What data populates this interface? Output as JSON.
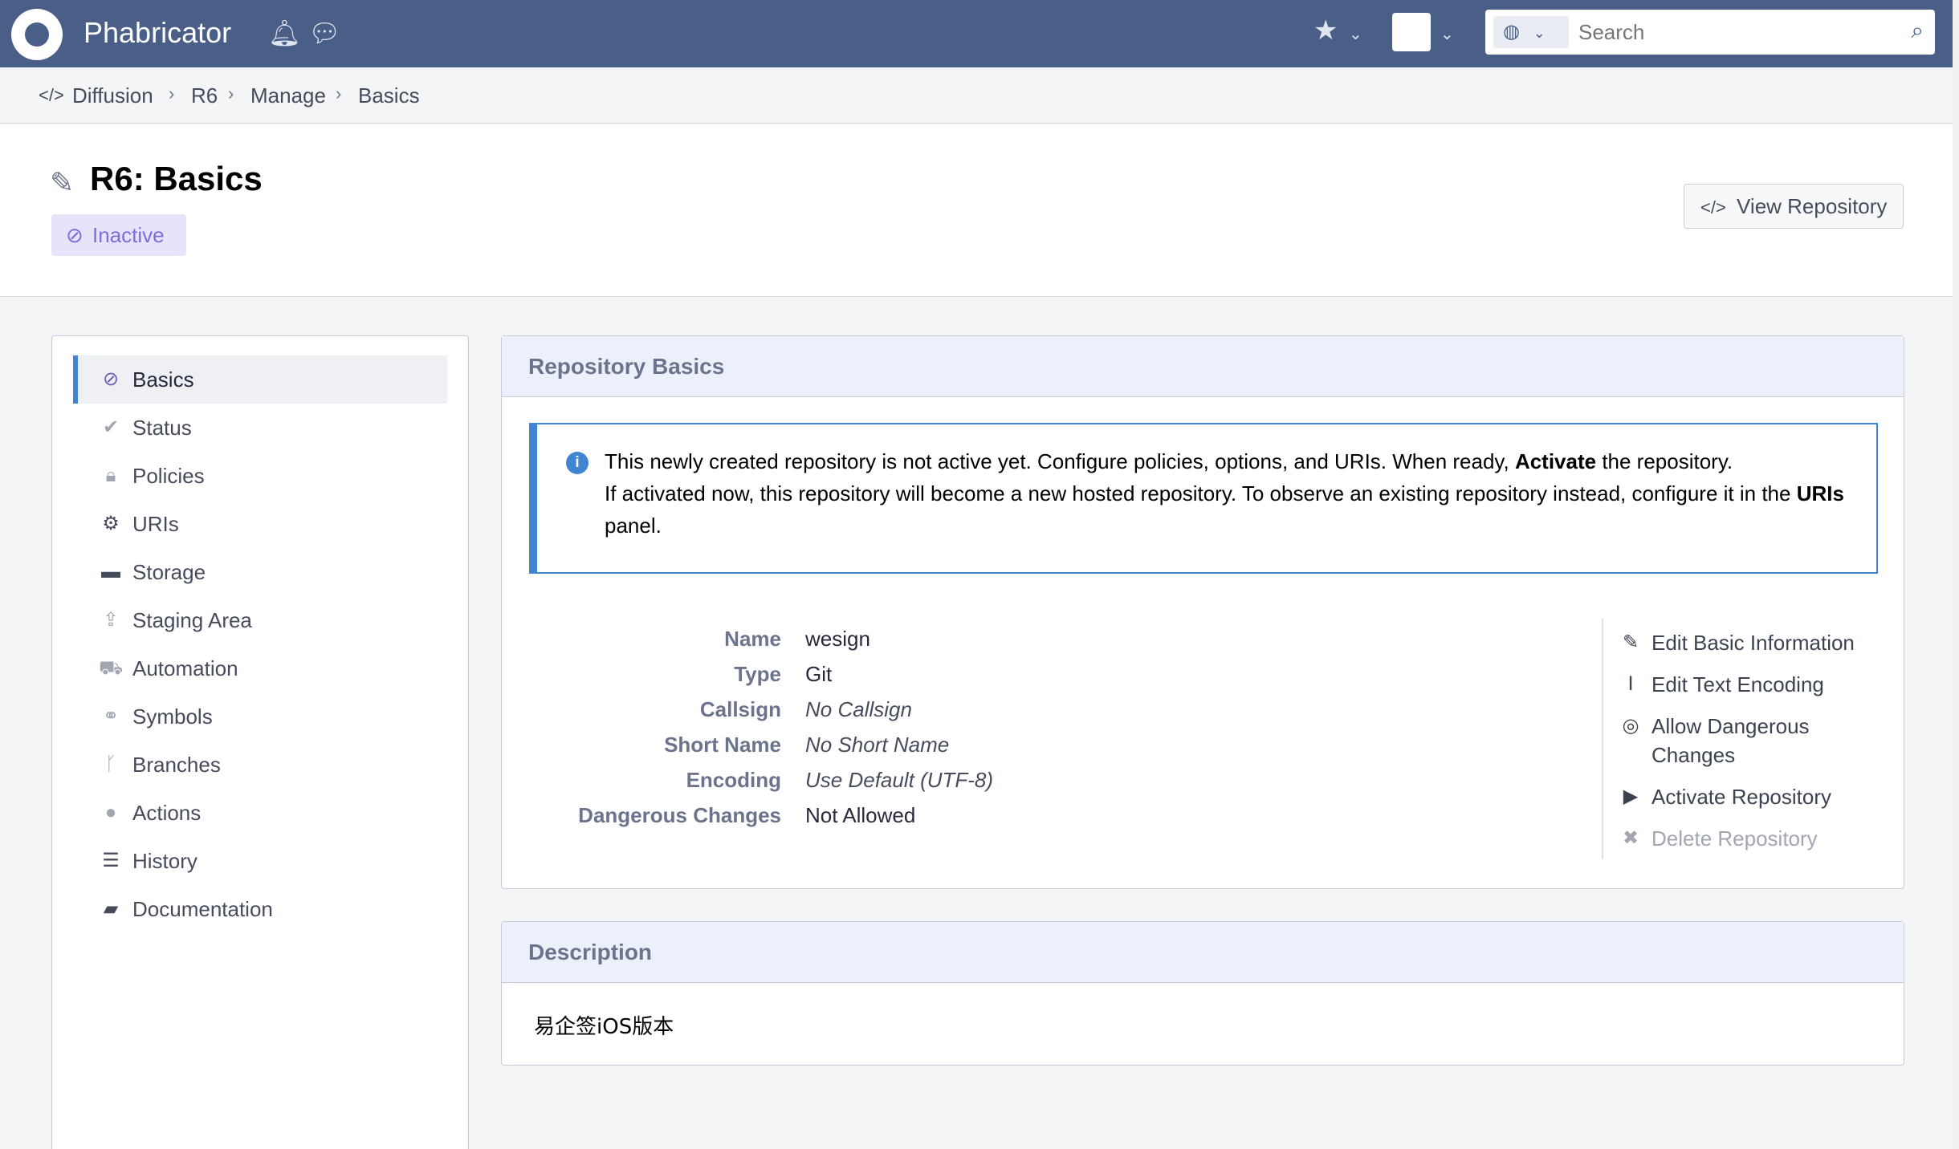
{
  "topbar": {
    "brand": "Phabricator",
    "search_placeholder": "Search"
  },
  "breadcrumbs": [
    "Diffusion",
    "R6",
    "Manage",
    "Basics"
  ],
  "header": {
    "title": "R6: Basics",
    "status": "Inactive",
    "view_button": "View Repository"
  },
  "sidebar": {
    "items": [
      {
        "label": "Basics",
        "icon": "ban-icon"
      },
      {
        "label": "Status",
        "icon": "check-icon"
      },
      {
        "label": "Policies",
        "icon": "lock-icon"
      },
      {
        "label": "URIs",
        "icon": "gears-icon"
      },
      {
        "label": "Storage",
        "icon": "folder-icon"
      },
      {
        "label": "Staging Area",
        "icon": "upload-icon"
      },
      {
        "label": "Automation",
        "icon": "truck-icon"
      },
      {
        "label": "Symbols",
        "icon": "link-icon"
      },
      {
        "label": "Branches",
        "icon": "branch-icon"
      },
      {
        "label": "Actions",
        "icon": "comment-icon"
      },
      {
        "label": "History",
        "icon": "list-icon"
      },
      {
        "label": "Documentation",
        "icon": "book-icon"
      }
    ]
  },
  "basics_panel": {
    "title": "Repository Basics",
    "notice_line1_pre": "This newly created repository is not active yet. Configure policies, options, and URIs. When ready, ",
    "notice_activate": "Activate",
    "notice_line1_post": " the repository.",
    "notice_line2_pre": "If activated now, this repository will become a new hosted repository. To observe an existing repository instead, configure it in the ",
    "notice_uris": "URIs",
    "notice_line2_post": " panel.",
    "properties": [
      {
        "label": "Name",
        "value": "wesign"
      },
      {
        "label": "Type",
        "value": "Git"
      },
      {
        "label": "Callsign",
        "value": "No Callsign"
      },
      {
        "label": "Short Name",
        "value": "No Short Name"
      },
      {
        "label": "Encoding",
        "value": "Use Default (UTF-8)"
      },
      {
        "label": "Dangerous Changes",
        "value": "Not Allowed"
      }
    ],
    "actions": [
      {
        "label": "Edit Basic Information"
      },
      {
        "label": "Edit Text Encoding"
      },
      {
        "label": "Allow Dangerous Changes"
      },
      {
        "label": "Activate Repository"
      },
      {
        "label": "Delete Repository"
      }
    ]
  },
  "description_panel": {
    "title": "Description",
    "text": "易企签iOS版本"
  }
}
